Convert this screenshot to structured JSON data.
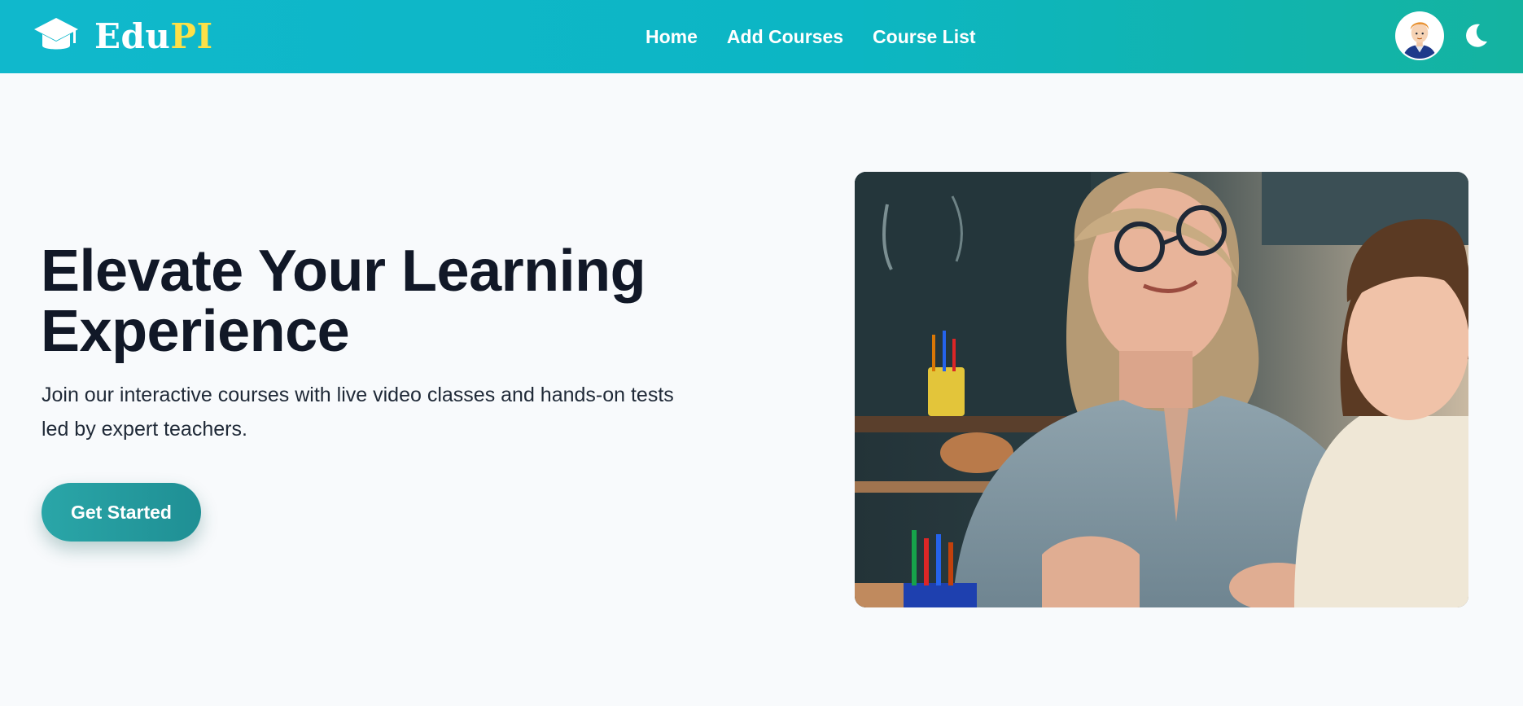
{
  "header": {
    "brand": {
      "name_main": "Edu",
      "name_accent": "PI",
      "accent_color": "#fde047",
      "icon": "graduation-cap-icon"
    },
    "nav": [
      {
        "label": "Home"
      },
      {
        "label": "Add Courses"
      },
      {
        "label": "Course List"
      }
    ],
    "avatar": {
      "icon": "user-avatar"
    },
    "theme_toggle": {
      "icon": "moon-icon"
    },
    "gradient": [
      "#10b8cc",
      "#14b3a0"
    ]
  },
  "hero": {
    "title": "Elevate Your Learning Experience",
    "subtitle": "Join our interactive courses with live video classes and hands-on tests led by expert teachers.",
    "cta_label": "Get Started",
    "cta_color": "#2aa6a8",
    "image": {
      "alt": "Teacher smiling at a young student in a classroom"
    }
  }
}
